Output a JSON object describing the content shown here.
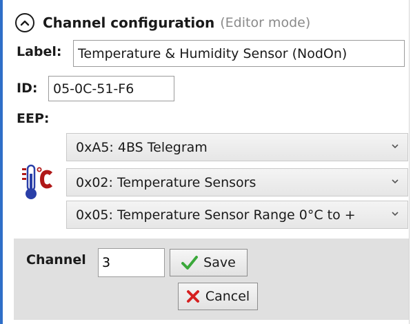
{
  "header": {
    "title": "Channel configuration",
    "subtitle": "(Editor mode)"
  },
  "label_field": {
    "label": "Label:",
    "value": "Temperature & Humidity Sensor (NodOn)"
  },
  "id_field": {
    "label": "ID:",
    "value": "05-0C-51-F6"
  },
  "eep": {
    "label": "EEP:",
    "icon": "thermometer-celsius-icon",
    "dropdowns": [
      {
        "value": "0xA5: 4BS Telegram"
      },
      {
        "value": "0x02: Temperature Sensors"
      },
      {
        "value": "0x05: Temperature Sensor Range 0°C to +"
      }
    ]
  },
  "channel": {
    "label": "Channel",
    "value": "3"
  },
  "buttons": {
    "save_label": "Save",
    "cancel_label": "Cancel"
  },
  "colors": {
    "accent": "#2f6fc8",
    "save_check": "#3aa83a",
    "cancel_x": "#d62020",
    "thermo_red": "#b01818",
    "thermo_blue": "#2a3fa8"
  }
}
